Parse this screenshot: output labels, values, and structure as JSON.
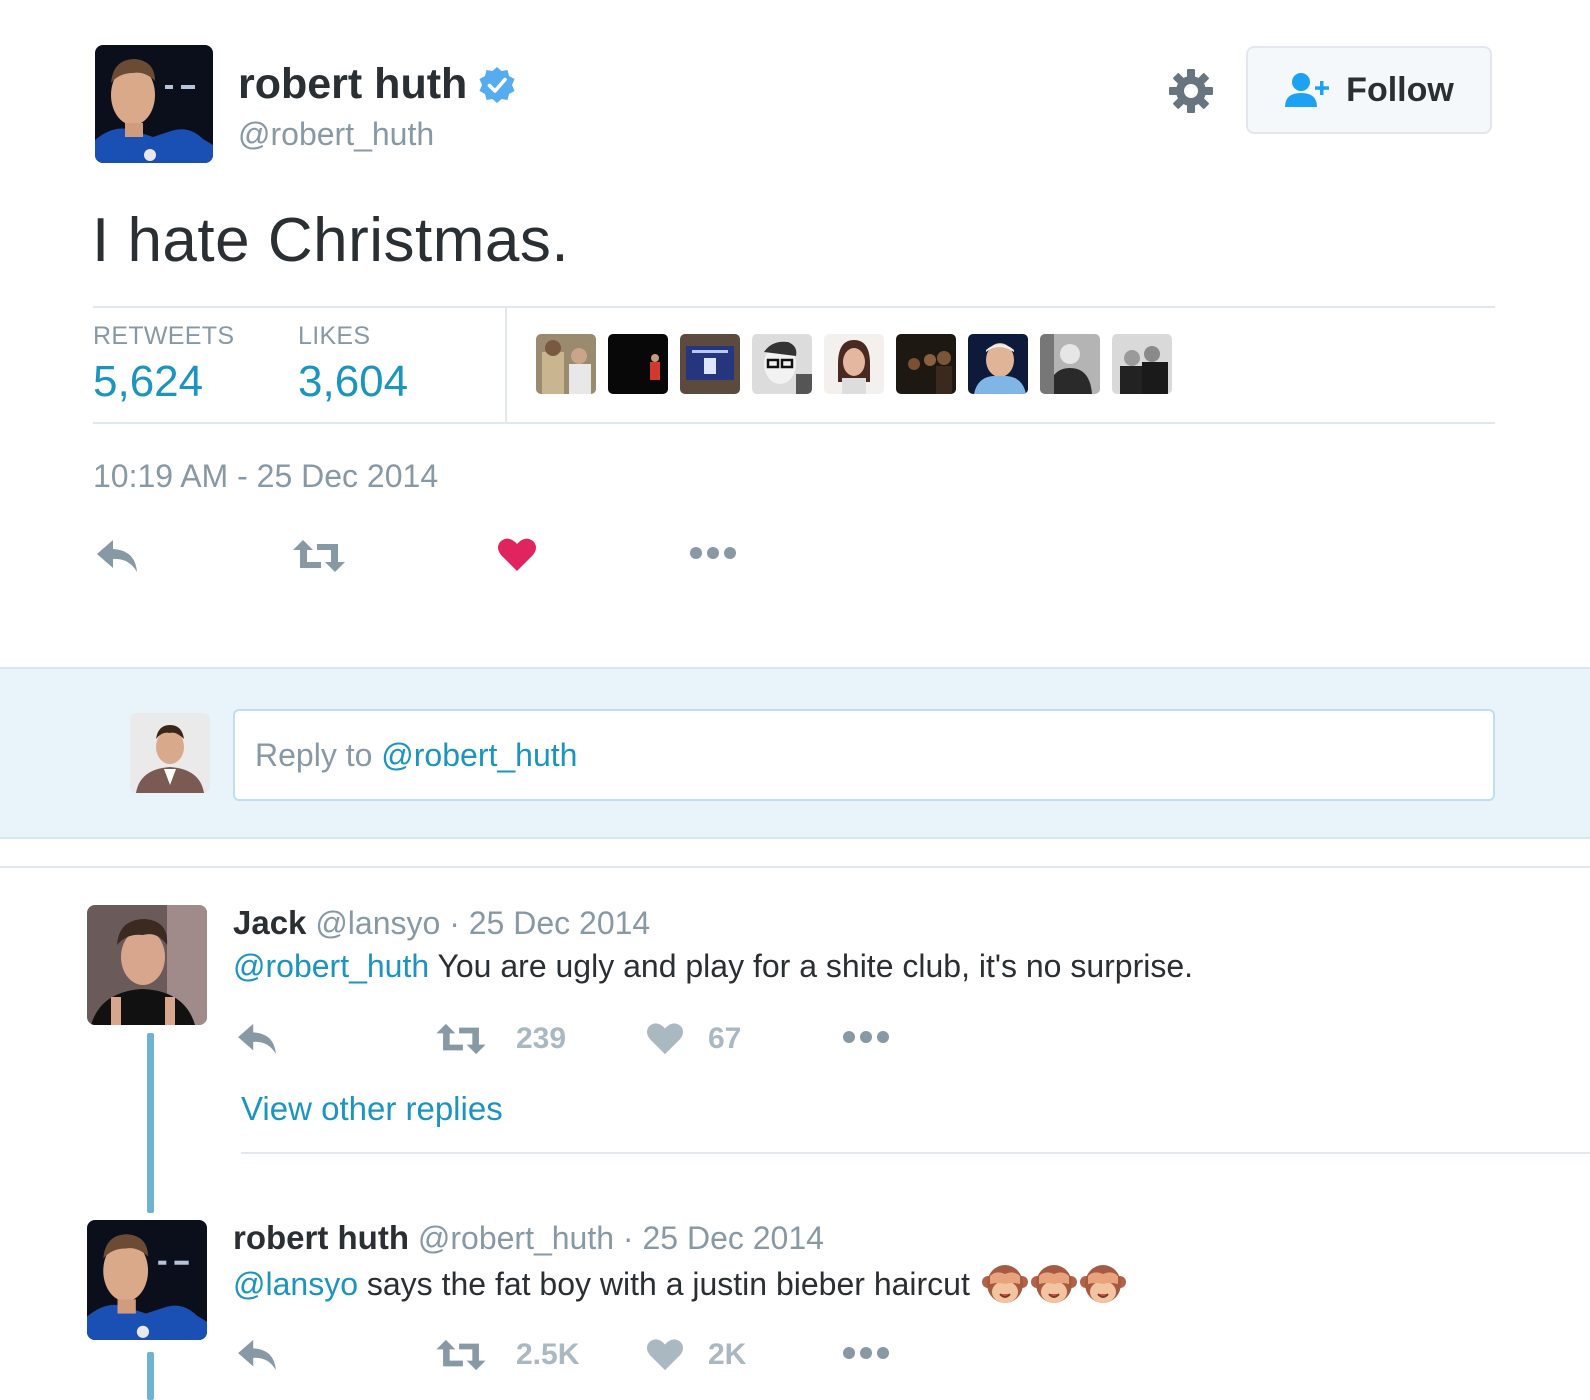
{
  "tweet": {
    "author_name": "robert huth",
    "author_handle": "@robert_huth",
    "text": "I hate Christmas.",
    "follow_label": "Follow",
    "retweets_label": "RETWEETS",
    "retweets_count": "5,624",
    "likes_label": "LIKES",
    "likes_count": "3,604",
    "timestamp": "10:19 AM - 25 Dec 2014",
    "liked": true
  },
  "colors": {
    "accent": "#1b95bf",
    "like_red": "#e0245e",
    "muted": "#8899a6",
    "verified": "#55acee",
    "thread_line": "#6eb4d2"
  },
  "reply_box": {
    "prefix": "Reply to ",
    "mention": "@robert_huth"
  },
  "replies": [
    {
      "name": "Jack",
      "handle": "@lansyo",
      "separator": " · ",
      "date": "25 Dec 2014",
      "mention": "@robert_huth",
      "text": " You are ugly and play for a shite club, it's no surprise.",
      "retweets": "239",
      "likes": "67"
    },
    {
      "name": "robert huth",
      "handle": "@robert_huth",
      "separator": " · ",
      "date": "25 Dec 2014",
      "mention": "@lansyo",
      "text": " says the fat boy with a justin bieber haircut",
      "emoji": [
        "see-no-evil-monkey-icon",
        "see-no-evil-monkey-icon",
        "see-no-evil-monkey-icon"
      ],
      "retweets": "2.5K",
      "likes": "2K"
    }
  ],
  "view_other_replies": "View other replies"
}
